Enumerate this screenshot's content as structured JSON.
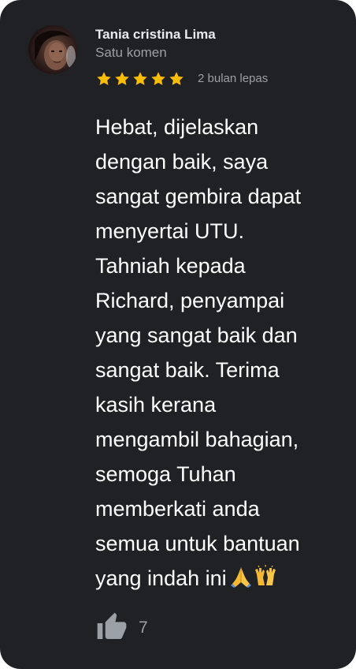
{
  "review": {
    "author_name": "Tania cristina Lima",
    "author_subtitle": "Satu komen",
    "rating": 5,
    "rating_max": 5,
    "time_ago": "2 bulan lepas",
    "body_lines": [
      "Hebat, dijelaskan",
      "dengan baik, saya",
      "sangat gembira dapat",
      "menyertai UTU.",
      "Tahniah kepada",
      "Richard, penyampai",
      "yang sangat baik dan",
      "sangat baik. Terima",
      "kasih kerana",
      "mengambil bahagian,",
      "semoga Tuhan",
      "memberkati anda",
      "semua untuk bantuan",
      "yang indah ini"
    ],
    "emojis": [
      "folded-hands-emoji",
      "raising-hands-emoji"
    ],
    "like_count": "7"
  },
  "colors": {
    "background": "#202124",
    "star": "#fbbc04",
    "primary_text": "#ffffff",
    "secondary_text": "#9aa0a6"
  }
}
